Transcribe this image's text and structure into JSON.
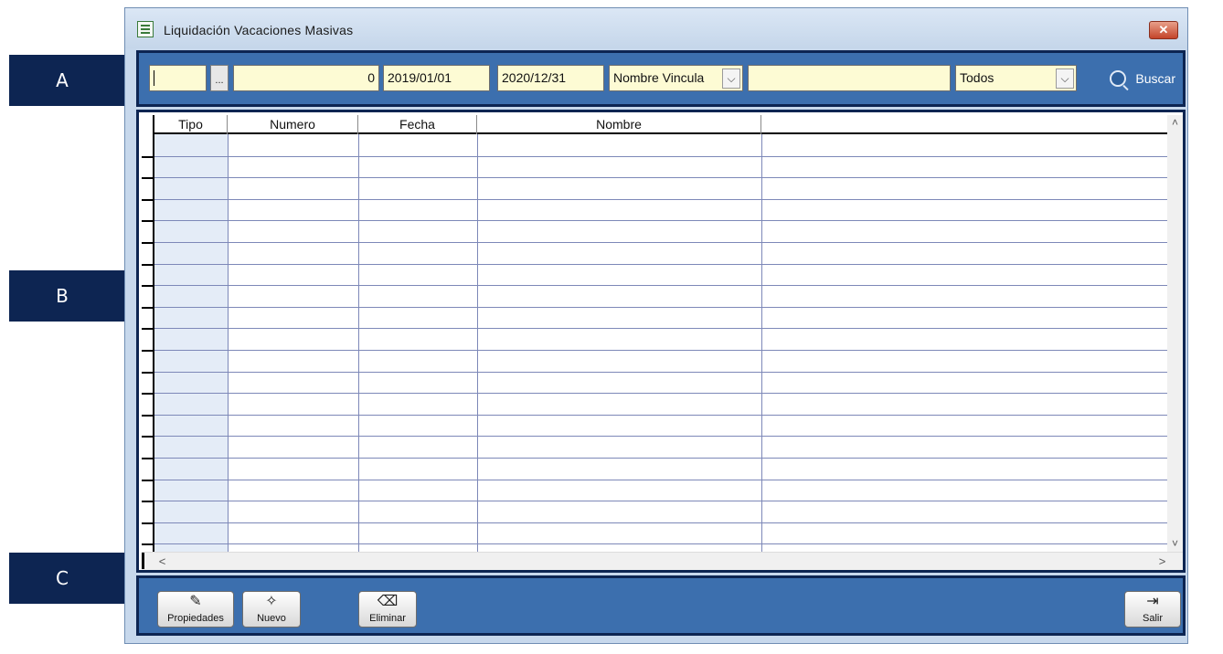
{
  "callouts": {
    "a": "A",
    "b": "B",
    "c": "C"
  },
  "window": {
    "title": "Liquidación Vacaciones Masivas",
    "close_glyph": "✕"
  },
  "toolbar": {
    "code_value": "",
    "ellipsis_label": "...",
    "number_value": "0",
    "date_from": "2019/01/01",
    "date_to": "2020/12/31",
    "name_filter": "Nombre Vincula",
    "search_text": "",
    "status_filter": "Todos",
    "dropdown_arrow": "⌵",
    "search_label": "Buscar",
    "search_icon": "search-icon"
  },
  "grid": {
    "columns": [
      "Tipo",
      "Numero",
      "Fecha",
      "Nombre"
    ],
    "rows": [],
    "scroll_up": "˄",
    "scroll_down": "˅",
    "scroll_left": "<",
    "scroll_right": ">"
  },
  "actions": {
    "properties_label": "Propiedades",
    "new_label": "Nuevo",
    "delete_label": "Eliminar",
    "exit_label": "Salir",
    "properties_icon": "properties-icon",
    "new_icon": "new-document-icon",
    "delete_icon": "eraser-icon",
    "exit_icon": "exit-door-icon"
  }
}
